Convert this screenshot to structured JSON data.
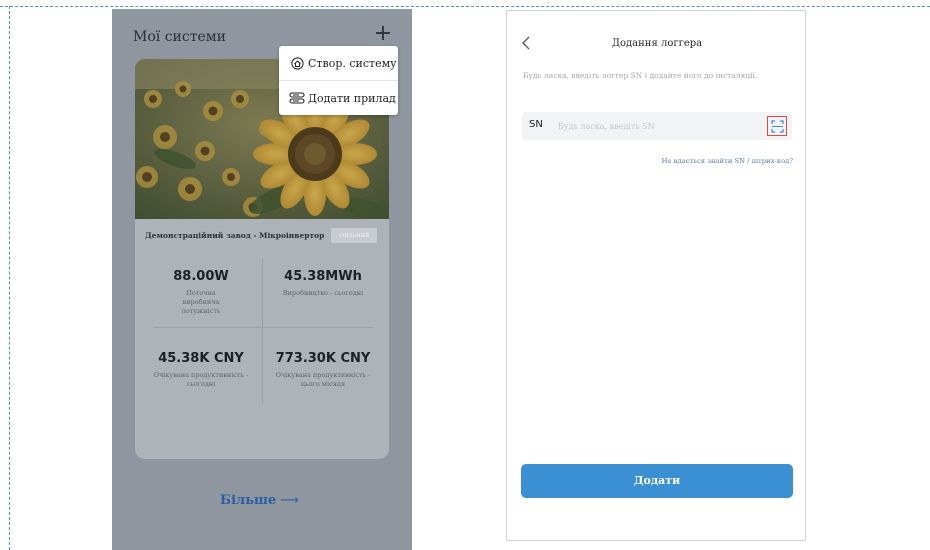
{
  "left_phone": {
    "title": "Мої системи",
    "card": {
      "name": "Демонстраційний завод - Мікроінвертор",
      "badge": "спільний",
      "stats": [
        {
          "value": "88.00W",
          "label": "Поточна виробнича потужність"
        },
        {
          "value": "45.38MWh",
          "label": "Виробництво - сьогодні"
        },
        {
          "value": "45.38K CNY",
          "label": "Очікувана продуктивність - сьогодні"
        },
        {
          "value": "773.30K CNY",
          "label": "Очікувана продуктивність - цього місяця"
        }
      ]
    },
    "more_label": "Більше",
    "more_arrow": "⟶",
    "dropdown": {
      "items": [
        {
          "label": "Створ. систему",
          "icon": "house-icon"
        },
        {
          "label": "Додати прилад",
          "icon": "device-icon"
        }
      ]
    },
    "colors": {
      "overlay": "#8f969f",
      "link": "#2a5da6"
    }
  },
  "right_phone": {
    "title": "Додання логгера",
    "hint": "Будь ласка, введіть логгер SN і додайте його до інсталяції.",
    "sn_label": "SN",
    "sn_placeholder": "Будь ласка, введіть SN",
    "help_link": "Не вдається знайти SN / штрих-код?",
    "submit_label": "Додати",
    "colors": {
      "accent": "#3b8fd3",
      "highlight": "#e04a3c"
    }
  }
}
